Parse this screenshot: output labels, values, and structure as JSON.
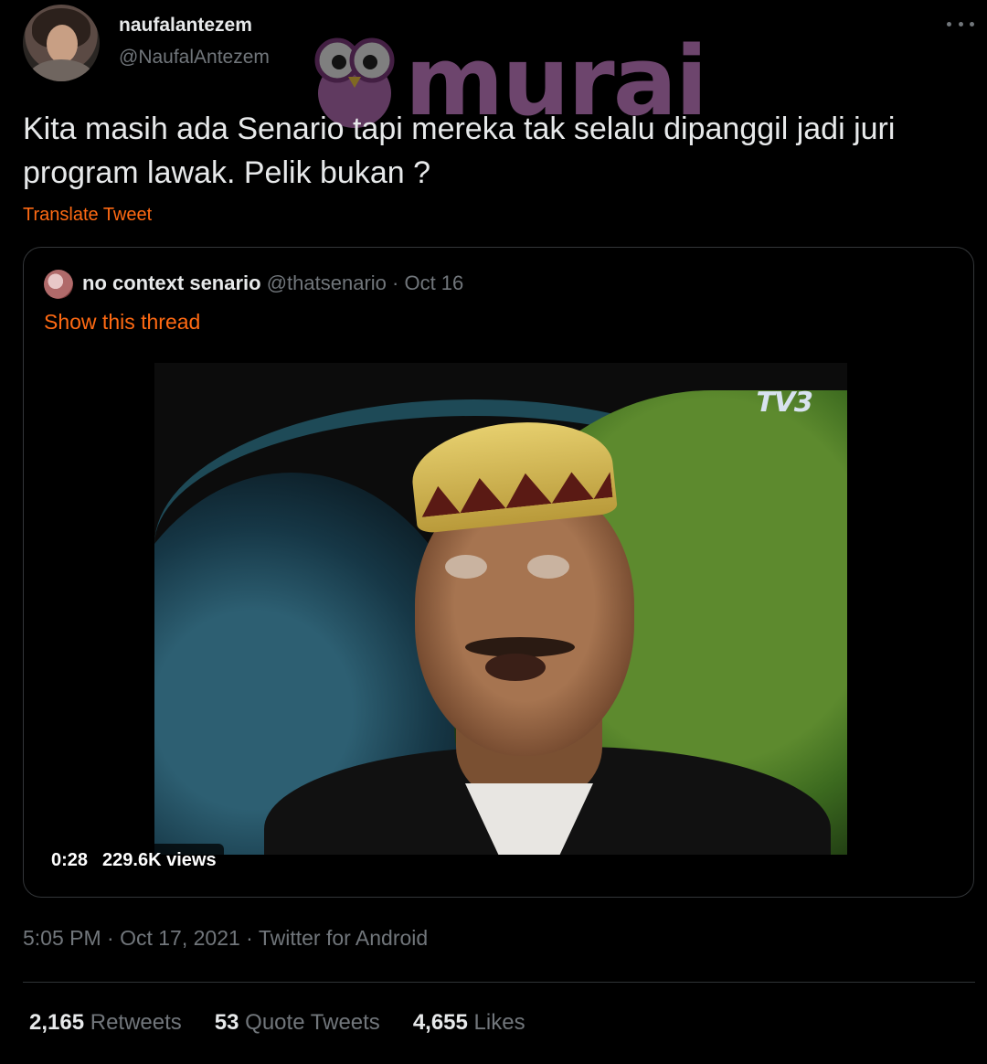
{
  "author": {
    "display_name": "naufalantezem",
    "handle": "@NaufalAntezem"
  },
  "watermark": {
    "text": "murai"
  },
  "tweet": {
    "text": "Kita masih ada Senario tapi mereka tak selalu dipanggil jadi juri program lawak. Pelik bukan ?",
    "translate_label": "Translate Tweet",
    "timestamp": "5:05 PM · Oct 17, 2021 · Twitter for Android"
  },
  "quoted_tweet": {
    "display_name": "no context senario",
    "handle": "@thatsenario",
    "date": " · Oct 16",
    "show_thread_label": "Show this thread",
    "video": {
      "duration": "0:28",
      "views": "229.6K views",
      "channel_logo": "TV3"
    }
  },
  "stats": [
    {
      "count": "2,165",
      "label": "Retweets"
    },
    {
      "count": "53",
      "label": "Quote Tweets"
    },
    {
      "count": "4,655",
      "label": "Likes"
    }
  ],
  "icons": {
    "more": "more-horizontal-icon"
  },
  "colors": {
    "background": "#000000",
    "text_primary": "#e7e9ea",
    "text_secondary": "#71767b",
    "accent": "#ff6a13",
    "border": "#333639"
  }
}
